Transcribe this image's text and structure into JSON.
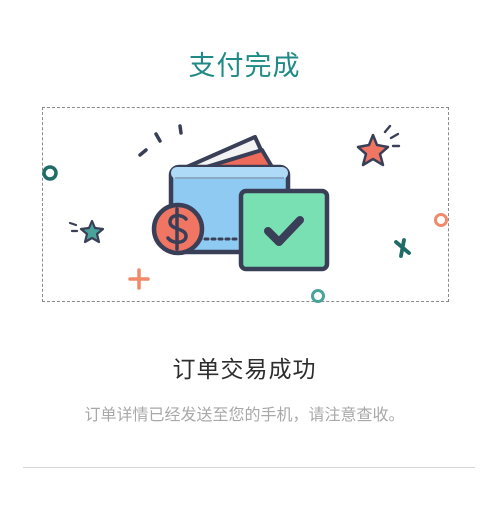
{
  "header": {
    "title": "支付完成"
  },
  "illustration": {
    "subject": "wallet-with-checkmark-card",
    "colors": {
      "outline": "#3a3f58",
      "wallet": "#8fcaf2",
      "card_back": "#ee6a5a",
      "coin": "#f07563",
      "check_card": "#79e0b3",
      "teal": "#1f6b68",
      "star_red": "#f07563",
      "star_teal": "#4aa39b",
      "plus_orange": "#f08a6a"
    }
  },
  "result": {
    "title": "订单交易成功",
    "description": "订单详情已经发送至您的手机，请注意查收。"
  }
}
